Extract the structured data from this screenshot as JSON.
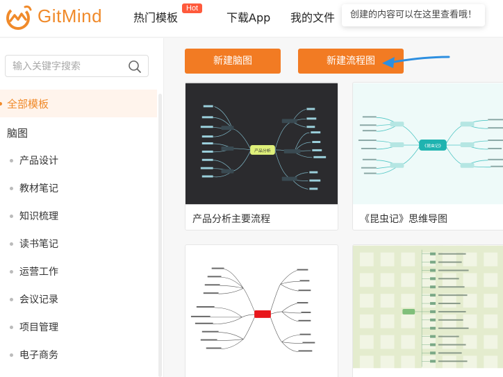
{
  "brand": {
    "name": "GitMind"
  },
  "nav": {
    "hot_templates": "热门模板",
    "hot_badge": "Hot",
    "download_app": "下载App",
    "my_files": "我的文件"
  },
  "tooltip": "创建的内容可以在这里查看哦！",
  "sidebar": {
    "search_placeholder": "输入关键字搜索",
    "active_category": "全部模板",
    "category": "脑图",
    "items": [
      {
        "label": "产品设计"
      },
      {
        "label": "教材笔记"
      },
      {
        "label": "知识梳理"
      },
      {
        "label": "读书笔记"
      },
      {
        "label": "运营工作"
      },
      {
        "label": "会议记录"
      },
      {
        "label": "项目管理"
      },
      {
        "label": "电子商务"
      }
    ]
  },
  "actions": {
    "new_mindmap": "新建脑图",
    "new_flowchart": "新建流程图"
  },
  "templates": [
    {
      "title": "产品分析主要流程",
      "center": "产品分析"
    },
    {
      "title": "《昆虫记》思维导图",
      "center": "《昆虫记》"
    }
  ],
  "colors": {
    "brand": "#f08a2a",
    "button": "#f27b23",
    "hot": "#ff5a3c",
    "arrow": "#2d8fe0"
  }
}
